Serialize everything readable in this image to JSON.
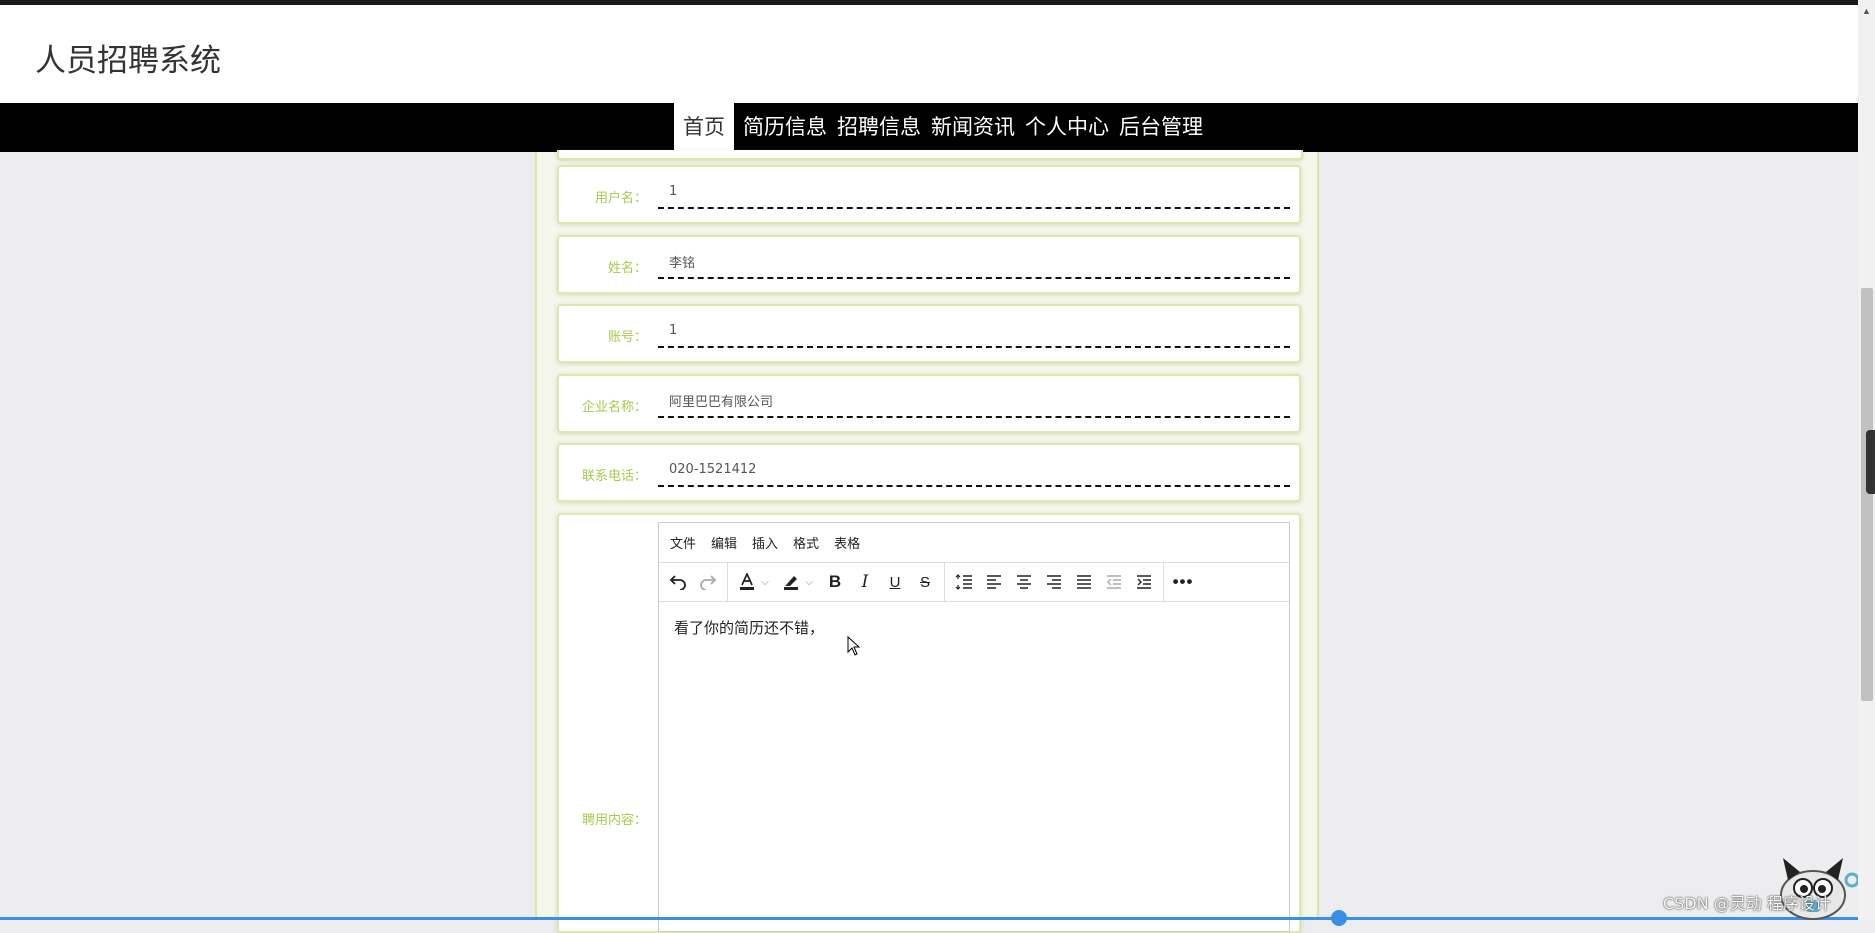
{
  "header": {
    "title": "人员招聘系统"
  },
  "nav": {
    "items": [
      "首页",
      "简历信息",
      "招聘信息",
      "新闻资讯",
      "个人中心",
      "后台管理"
    ],
    "active_index": 0
  },
  "form": {
    "username": {
      "label": "用户名：",
      "value": "1"
    },
    "name": {
      "label": "姓名：",
      "value": "李铭"
    },
    "account": {
      "label": "账号：",
      "value": "1"
    },
    "company": {
      "label": "企业名称：",
      "value": "阿里巴巴有限公司"
    },
    "phone": {
      "label": "联系电话：",
      "value": "020-1521412"
    },
    "content": {
      "label": "聘用内容：",
      "menubar": [
        "文件",
        "编辑",
        "插入",
        "格式",
        "表格"
      ],
      "text": "看了你的简历还不错，"
    }
  },
  "watermark": "CSDN @灵动 程序设计",
  "colors": {
    "accent": "#a8c94e",
    "navbar": "#000000",
    "border": "#dbe9ad"
  }
}
